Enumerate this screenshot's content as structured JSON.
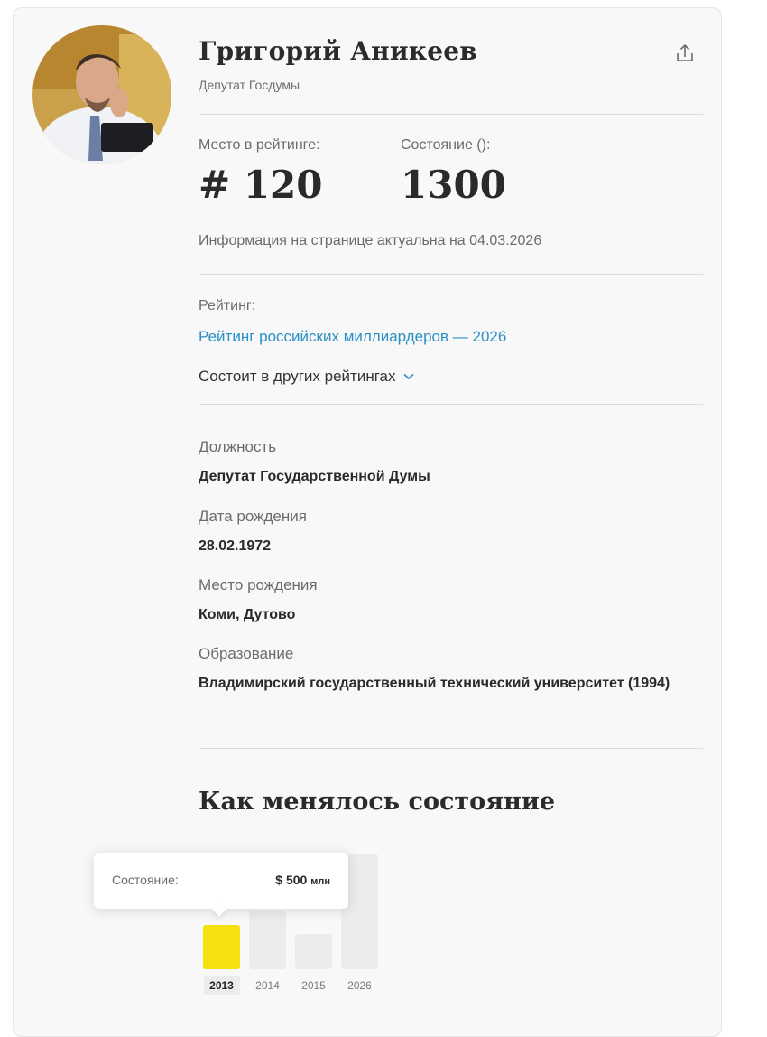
{
  "profile": {
    "name": "Григорий Аникеев",
    "subtitle": "Депутат Госдумы",
    "avatar_alt": "portrait",
    "share_icon": "share-icon"
  },
  "stats": {
    "rank_label": "Место в рейтинге:",
    "rank_value": "# 120",
    "wealth_label": "Состояние ():",
    "wealth_value": "1300"
  },
  "info_date": "Информация на странице актуальна на 04.03.2026",
  "rating": {
    "label": "Рейтинг:",
    "link_text": "Рейтинг российских миллиардеров — 2026",
    "other_ratings_label": "Состоит в других рейтингах",
    "other_ratings_icon": "chevron-down-icon"
  },
  "facts": [
    {
      "label": "Должность",
      "value": "Депутат Государственной Думы"
    },
    {
      "label": "Дата рождения",
      "value": "28.02.1972"
    },
    {
      "label": "Место рождения",
      "value": "Коми, Дутово"
    },
    {
      "label": "Образование",
      "value": "Владимирский государственный технический университет (1994)"
    }
  ],
  "section_title": "Как менялось состояние",
  "tooltip": {
    "label": "Состояние:",
    "value": "$ 500",
    "unit": "млн"
  },
  "chart_data": {
    "type": "bar",
    "categories": [
      "2013",
      "2014",
      "2015",
      "2026"
    ],
    "values": [
      500,
      650,
      400,
      1300
    ],
    "selected": "2013",
    "colors": {
      "selected": "#f4e10f",
      "default": "#ececec"
    },
    "title": "",
    "xlabel": "",
    "ylabel": ""
  },
  "colors": {
    "accent_link": "#2a8fc7",
    "highlight": "#f4e10f"
  }
}
